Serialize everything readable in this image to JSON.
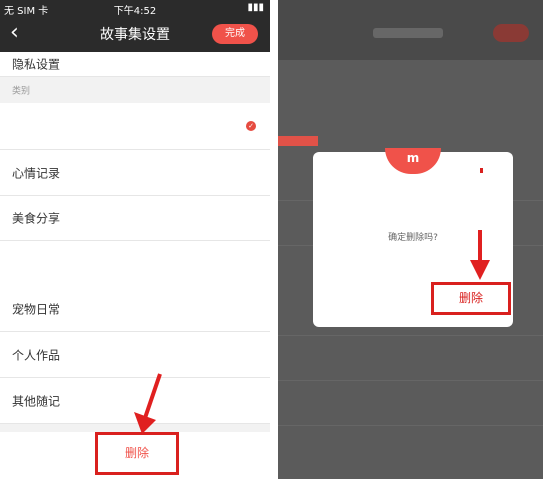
{
  "left": {
    "status": {
      "carrier": "无 SIM 卡",
      "time": "下午4:52"
    },
    "nav": {
      "title": "故事集设置",
      "done_label": "完成"
    },
    "privacy_label": "隐私设置",
    "section_label": "类别",
    "categories": [
      "心情记录",
      "美食分享",
      "宠物日常",
      "个人作品",
      "其他随记"
    ],
    "delete_label": "删除"
  },
  "right": {
    "dialog": {
      "message": "确定删除吗?",
      "delete_label": "删除",
      "tab_glyph": "m"
    }
  },
  "colors": {
    "accent": "#f0524a",
    "highlight": "#d9201e"
  }
}
